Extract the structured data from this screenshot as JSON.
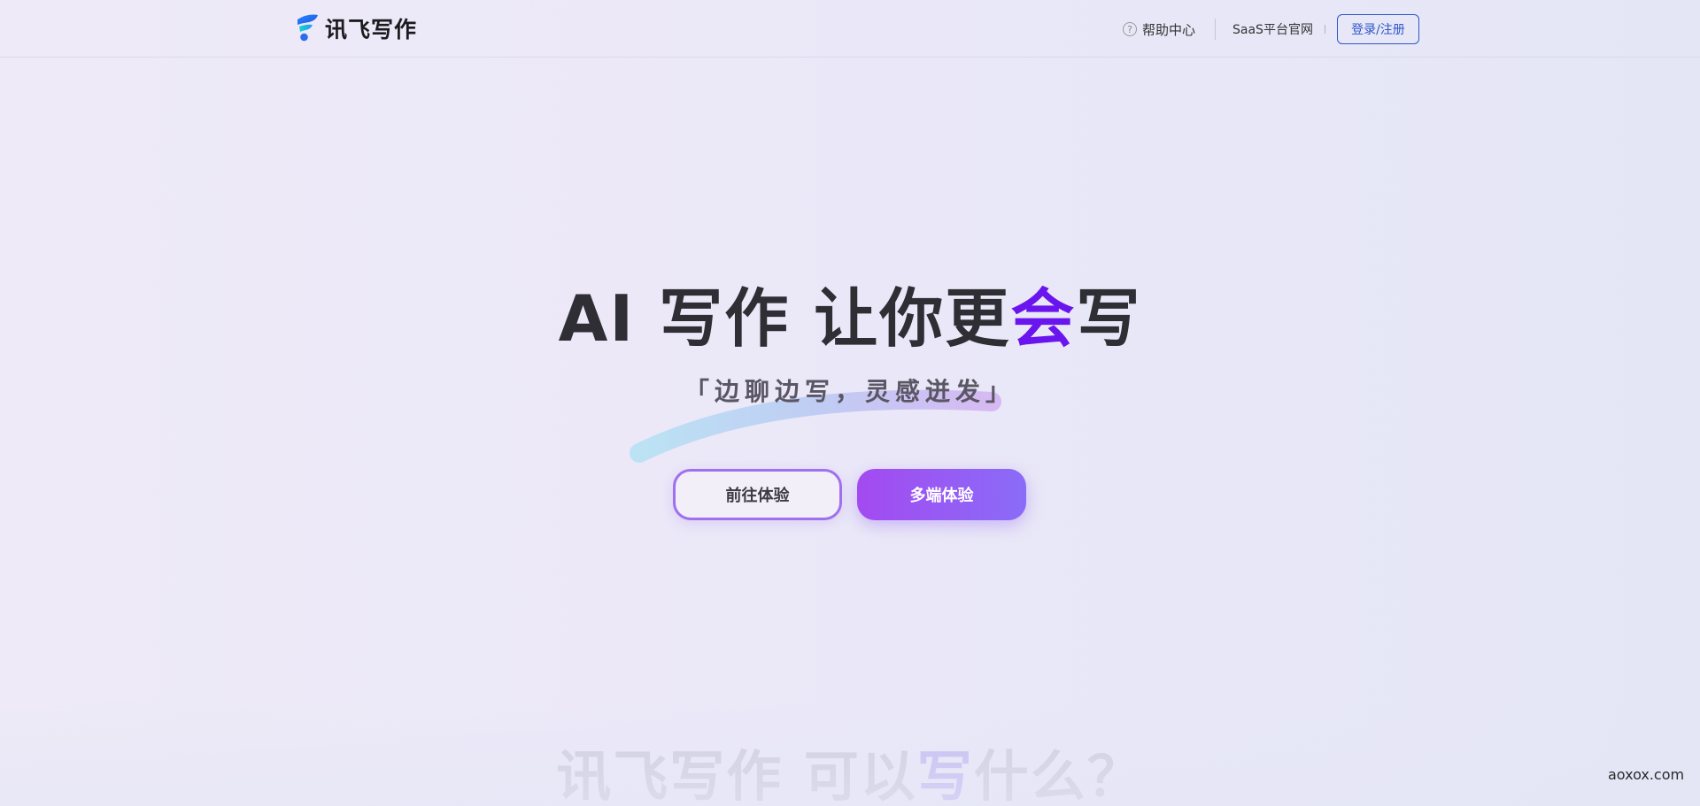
{
  "header": {
    "logo_text": "讯飞写作",
    "help_label": "帮助中心",
    "help_icon_glyph": "?",
    "saas_label": "SaaS平台官网",
    "login_label": "登录/注册"
  },
  "hero": {
    "title_part1": "AI 写作 让你更",
    "title_accent": "会",
    "title_part2": "写",
    "slogan": "「边聊边写，灵感迸发」",
    "btn_try": "前往体验",
    "btn_multi": "多端体验"
  },
  "section_peek": {
    "part1": "讯飞写作 可以",
    "accent": "写",
    "part2": "什么？"
  },
  "watermark": "aoxox.com",
  "colors": {
    "accent_purple": "#6a14ee",
    "login_blue": "#2f57c9",
    "button_gradient_start": "#a34af0",
    "button_gradient_end": "#8a6cf8"
  },
  "icons": {
    "logo": "xunfei-logo-icon",
    "help": "question-circle-icon"
  }
}
